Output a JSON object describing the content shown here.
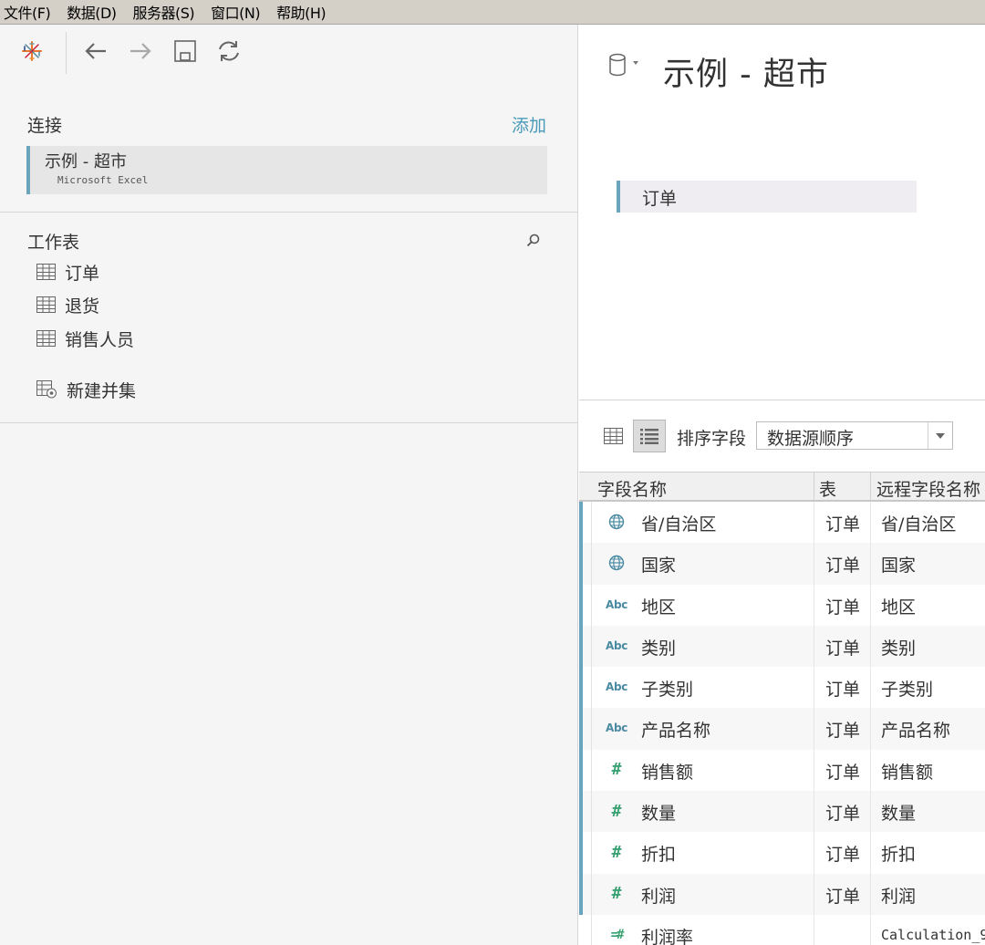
{
  "menu": {
    "items": [
      "文件(F)",
      "数据(D)",
      "服务器(S)",
      "窗口(N)",
      "帮助(H)"
    ]
  },
  "toolbar": {
    "icons": [
      "tableau-logo-icon",
      "back-arrow-icon",
      "forward-arrow-icon",
      "save-icon",
      "refresh-icon"
    ]
  },
  "connections": {
    "label": "连接",
    "add_label": "添加",
    "items": [
      {
        "name": "示例 - 超市",
        "type": "Microsoft Excel"
      }
    ]
  },
  "worksheets": {
    "label": "工作表",
    "items": [
      {
        "label": "订单",
        "icon": "table-icon"
      },
      {
        "label": "退货",
        "icon": "table-icon"
      },
      {
        "label": "销售人员",
        "icon": "table-icon"
      }
    ],
    "new_union_label": "新建并集"
  },
  "datasource": {
    "title": "示例 - 超市",
    "canvas_table": "订单"
  },
  "sort": {
    "label": "排序字段",
    "selected": "数据源顺序"
  },
  "fields": {
    "headers": [
      "字段名称",
      "表",
      "远程字段名称"
    ],
    "rows": [
      {
        "type": "geo",
        "name": "省/自治区",
        "table": "订单",
        "remote": "省/自治区"
      },
      {
        "type": "geo",
        "name": "国家",
        "table": "订单",
        "remote": "国家"
      },
      {
        "type": "string",
        "name": "地区",
        "table": "订单",
        "remote": "地区"
      },
      {
        "type": "string",
        "name": "类别",
        "table": "订单",
        "remote": "类别"
      },
      {
        "type": "string",
        "name": "子类别",
        "table": "订单",
        "remote": "子类别"
      },
      {
        "type": "string",
        "name": "产品名称",
        "table": "订单",
        "remote": "产品名称"
      },
      {
        "type": "number",
        "name": "销售额",
        "table": "订单",
        "remote": "销售额"
      },
      {
        "type": "number",
        "name": "数量",
        "table": "订单",
        "remote": "数量"
      },
      {
        "type": "number",
        "name": "折扣",
        "table": "订单",
        "remote": "折扣"
      },
      {
        "type": "number",
        "name": "利润",
        "table": "订单",
        "remote": "利润"
      },
      {
        "type": "calc",
        "name": "利润率",
        "table": "",
        "remote": "Calculation_9"
      }
    ],
    "type_labels": {
      "string": "Abc",
      "number": "#",
      "calc": "=#"
    }
  },
  "colors": {
    "accent": "#6ba4bd",
    "link": "#4a9bb8",
    "number_icon": "#3aa272",
    "string_icon": "#4a8aa3"
  }
}
